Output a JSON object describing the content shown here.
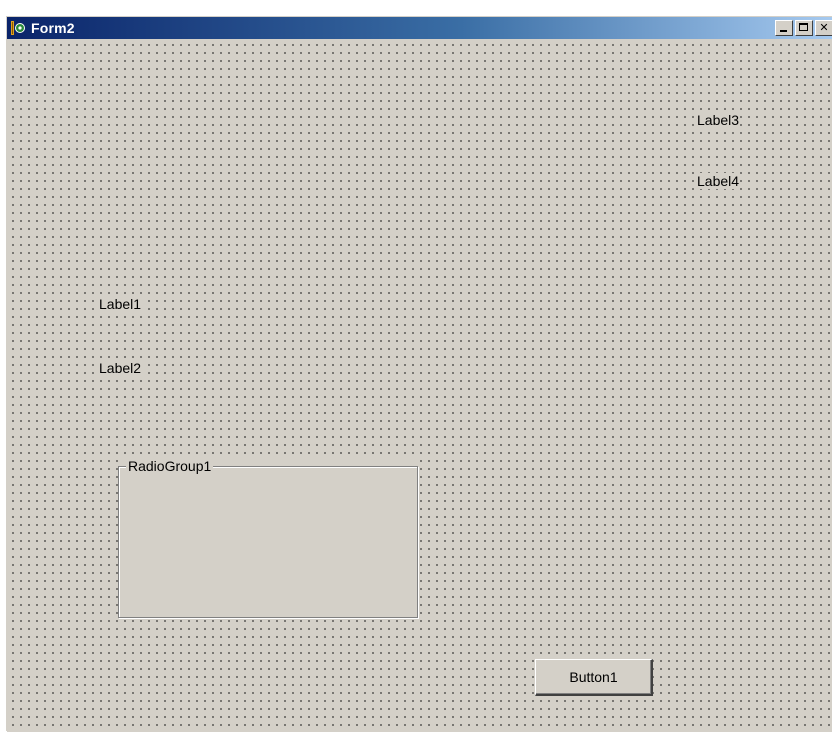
{
  "window": {
    "title": "Form2",
    "controls": {
      "minimize": "minimize-icon",
      "maximize": "maximize-icon",
      "close": "close-icon"
    }
  },
  "form": {
    "labels": {
      "label1": "Label1",
      "label2": "Label2",
      "label3": "Label3",
      "label4": "Label4"
    },
    "radiogroup": {
      "caption": "RadioGroup1"
    },
    "button": {
      "caption": "Button1"
    }
  },
  "colors": {
    "face": "#d4d0c8",
    "title_start": "#0a246a",
    "title_end": "#a6caf0",
    "grid_dot": "#000000"
  }
}
